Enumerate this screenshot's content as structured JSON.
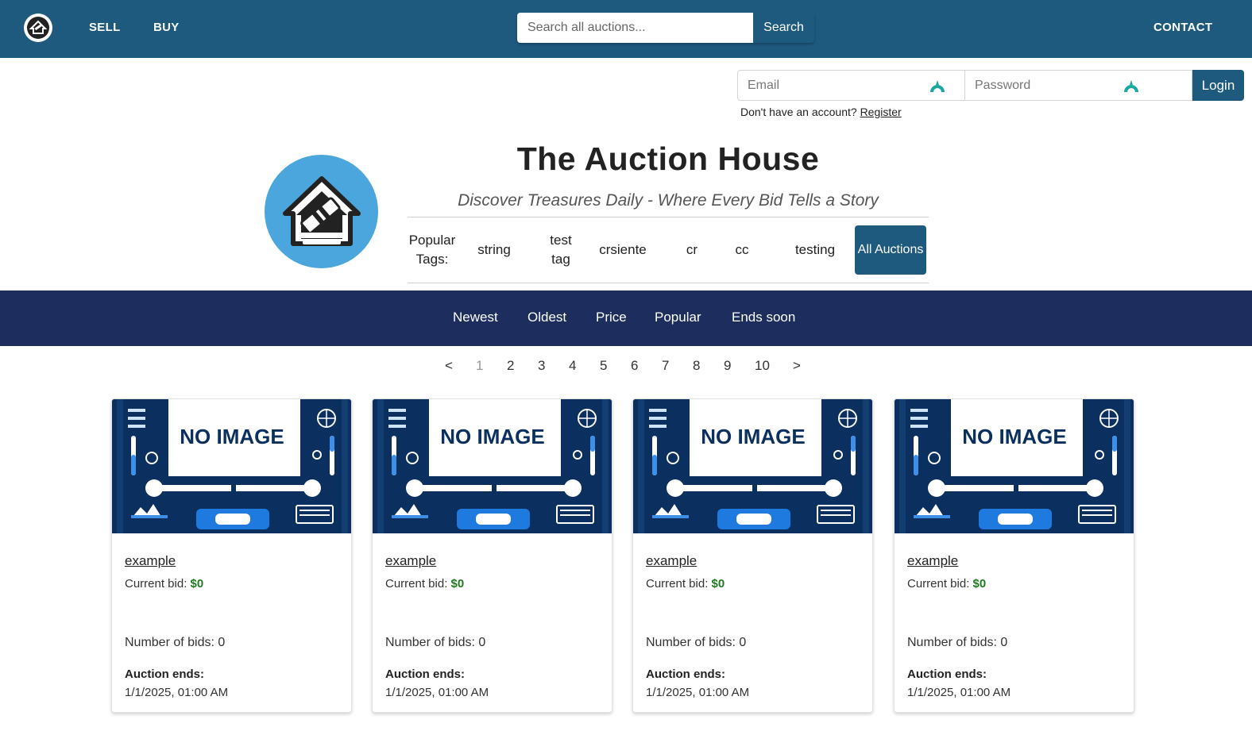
{
  "nav": {
    "links": {
      "sell": "SELL",
      "buy": "BUY",
      "contact": "CONTACT"
    },
    "search": {
      "placeholder": "Search all auctions...",
      "button": "Search"
    }
  },
  "login": {
    "email_placeholder": "Email",
    "password_placeholder": "Password",
    "button": "Login",
    "register_prompt": "Don't have an account?",
    "register_link": "Register"
  },
  "hero": {
    "title": "The Auction House",
    "tagline": "Discover Treasures Daily - Where Every Bid Tells a Story",
    "popular_tags_label": "Popular Tags:",
    "tags": [
      "string",
      "test tag",
      "crsiente",
      "cr",
      "cc",
      "testing"
    ],
    "all_auctions": "All Auctions"
  },
  "sort": {
    "options": [
      "Newest",
      "Oldest",
      "Price",
      "Popular",
      "Ends soon"
    ]
  },
  "pagination": {
    "prev": "<",
    "next": ">",
    "pages": [
      "1",
      "2",
      "3",
      "4",
      "5",
      "6",
      "7",
      "8",
      "9",
      "10"
    ],
    "current": "1"
  },
  "cards": [
    {
      "image_text": "NO IMAGE",
      "title": "example",
      "bid_label": "Current bid:",
      "bid_value": "$0",
      "bids": "Number of bids: 0",
      "ends_label": "Auction ends:",
      "ends_value": "1/1/2025, 01:00 AM"
    },
    {
      "image_text": "NO IMAGE",
      "title": "example",
      "bid_label": "Current bid:",
      "bid_value": "$0",
      "bids": "Number of bids: 0",
      "ends_label": "Auction ends:",
      "ends_value": "1/1/2025, 01:00 AM"
    },
    {
      "image_text": "NO IMAGE",
      "title": "example",
      "bid_label": "Current bid:",
      "bid_value": "$0",
      "bids": "Number of bids: 0",
      "ends_label": "Auction ends:",
      "ends_value": "1/1/2025, 01:00 AM"
    },
    {
      "image_text": "NO IMAGE",
      "title": "example",
      "bid_label": "Current bid:",
      "bid_value": "$0",
      "bids": "Number of bids: 0",
      "ends_label": "Auction ends:",
      "ends_value": "1/1/2025, 01:00 AM"
    }
  ],
  "colors": {
    "brand": "#1e5a7e",
    "sort_bar": "#1c2d5e",
    "logo_circle": "#4aa6dc",
    "price_green": "#1e7a1e"
  },
  "icons": {
    "nav_logo": "auction-house-logo-icon",
    "hero_logo": "auction-house-logo-icon",
    "password_manager": "password-manager-icon"
  }
}
